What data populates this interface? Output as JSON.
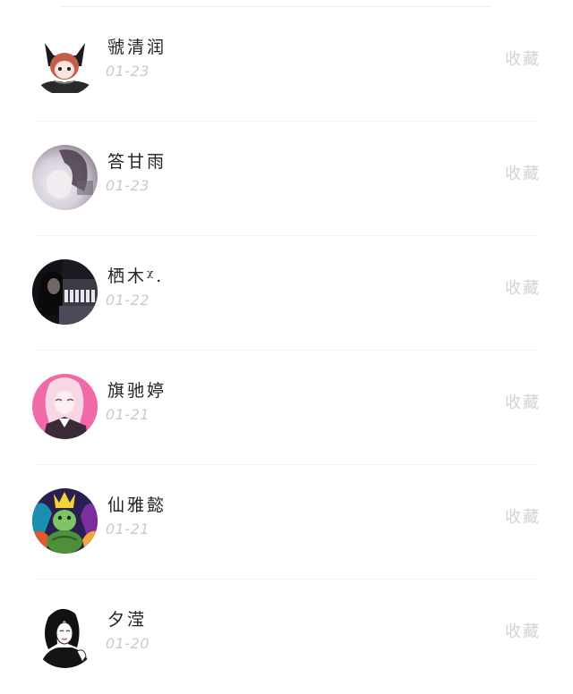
{
  "items": [
    {
      "name": "虢清润",
      "date": "01-23",
      "action": "收藏",
      "avatar": "cat-ear-anime-avatar"
    },
    {
      "name": "答甘雨",
      "date": "01-23",
      "action": "收藏",
      "avatar": "blurred-girl-photo-avatar"
    },
    {
      "name": "栖木ᵡ.",
      "date": "01-22",
      "action": "收藏",
      "avatar": "piano-player-photo-avatar"
    },
    {
      "name": "旗驰婷",
      "date": "01-21",
      "action": "收藏",
      "avatar": "pink-hair-anime-avatar"
    },
    {
      "name": "仙雅懿",
      "date": "01-21",
      "action": "收藏",
      "avatar": "crowned-turtle-avatar"
    },
    {
      "name": "夕滢",
      "date": "01-20",
      "action": "收藏",
      "avatar": "sketch-girl-avatar"
    }
  ],
  "colors": {
    "name": "#222222",
    "date": "#c9c9c9",
    "action": "#d2d2d2",
    "divider": "#f0f0f0"
  }
}
